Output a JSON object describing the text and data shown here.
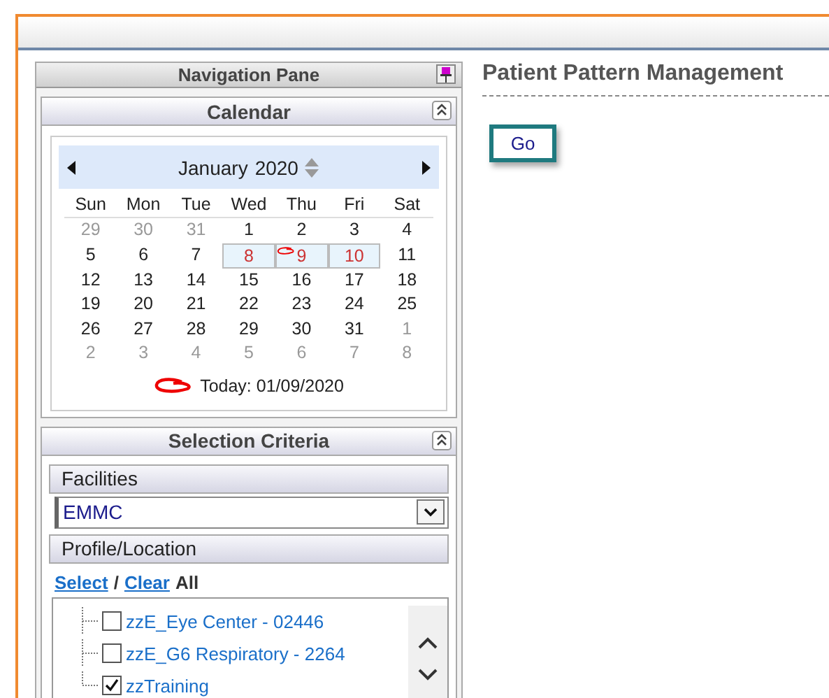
{
  "navigation_pane": {
    "title": "Navigation Pane"
  },
  "calendar": {
    "title": "Calendar",
    "expanded": true,
    "month": "January",
    "year": "2020",
    "weekdays": [
      "Sun",
      "Mon",
      "Tue",
      "Wed",
      "Thu",
      "Fri",
      "Sat"
    ],
    "weeks": [
      [
        {
          "day": "29",
          "muted": true,
          "selected": false
        },
        {
          "day": "30",
          "muted": true,
          "selected": false
        },
        {
          "day": "31",
          "muted": true,
          "selected": false
        },
        {
          "day": "1",
          "muted": false,
          "selected": false
        },
        {
          "day": "2",
          "muted": false,
          "selected": false
        },
        {
          "day": "3",
          "muted": false,
          "selected": false
        },
        {
          "day": "4",
          "muted": false,
          "selected": false
        }
      ],
      [
        {
          "day": "5",
          "muted": false,
          "selected": false
        },
        {
          "day": "6",
          "muted": false,
          "selected": false
        },
        {
          "day": "7",
          "muted": false,
          "selected": false
        },
        {
          "day": "8",
          "muted": false,
          "selected": true
        },
        {
          "day": "9",
          "muted": false,
          "selected": true
        },
        {
          "day": "10",
          "muted": false,
          "selected": true
        },
        {
          "day": "11",
          "muted": false,
          "selected": false
        }
      ],
      [
        {
          "day": "12",
          "muted": false,
          "selected": false
        },
        {
          "day": "13",
          "muted": false,
          "selected": false
        },
        {
          "day": "14",
          "muted": false,
          "selected": false
        },
        {
          "day": "15",
          "muted": false,
          "selected": false
        },
        {
          "day": "16",
          "muted": false,
          "selected": false
        },
        {
          "day": "17",
          "muted": false,
          "selected": false
        },
        {
          "day": "18",
          "muted": false,
          "selected": false
        }
      ],
      [
        {
          "day": "19",
          "muted": false,
          "selected": false
        },
        {
          "day": "20",
          "muted": false,
          "selected": false
        },
        {
          "day": "21",
          "muted": false,
          "selected": false
        },
        {
          "day": "22",
          "muted": false,
          "selected": false
        },
        {
          "day": "23",
          "muted": false,
          "selected": false
        },
        {
          "day": "24",
          "muted": false,
          "selected": false
        },
        {
          "day": "25",
          "muted": false,
          "selected": false
        }
      ],
      [
        {
          "day": "26",
          "muted": false,
          "selected": false
        },
        {
          "day": "27",
          "muted": false,
          "selected": false
        },
        {
          "day": "28",
          "muted": false,
          "selected": false
        },
        {
          "day": "29",
          "muted": false,
          "selected": false
        },
        {
          "day": "30",
          "muted": false,
          "selected": false
        },
        {
          "day": "31",
          "muted": false,
          "selected": false
        },
        {
          "day": "1",
          "muted": true,
          "selected": false
        }
      ],
      [
        {
          "day": "2",
          "muted": true,
          "selected": false
        },
        {
          "day": "3",
          "muted": true,
          "selected": false
        },
        {
          "day": "4",
          "muted": true,
          "selected": false
        },
        {
          "day": "5",
          "muted": true,
          "selected": false
        },
        {
          "day": "6",
          "muted": true,
          "selected": false
        },
        {
          "day": "7",
          "muted": true,
          "selected": false
        },
        {
          "day": "8",
          "muted": true,
          "selected": false
        }
      ]
    ],
    "today": "Today: 01/09/2020"
  },
  "selection_criteria": {
    "title": "Selection Criteria",
    "expanded": true,
    "facilities": {
      "label": "Facilities",
      "value": "EMMC"
    },
    "profile_location": {
      "label": "Profile/Location",
      "select_link": "Select",
      "separator": "/",
      "clear_link": "Clear",
      "all": "All",
      "items": [
        {
          "label": "zzE_Eye Center - 02446",
          "checked": false
        },
        {
          "label": "zzE_G6 Respiratory - 2264",
          "checked": false
        },
        {
          "label": "zzTraining",
          "checked": true
        }
      ]
    }
  },
  "main": {
    "title": "Patient Pattern Management",
    "go_button": "Go"
  }
}
